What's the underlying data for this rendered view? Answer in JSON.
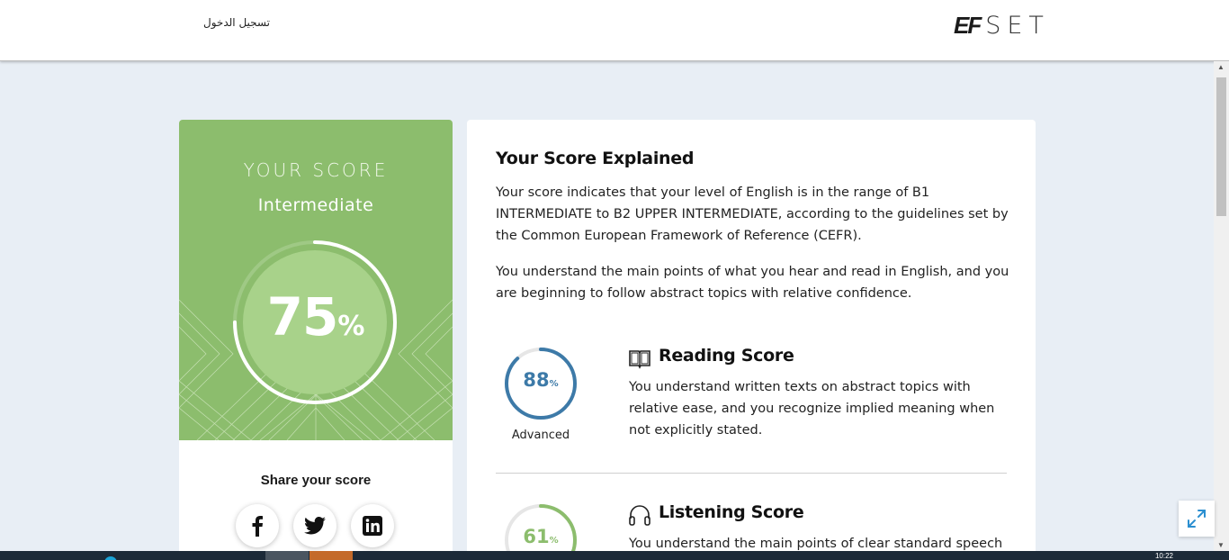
{
  "header": {
    "login_label": "تسجيل الدخول",
    "logo_ef": "EF",
    "logo_set": "SET"
  },
  "score_card": {
    "heading": "YOUR SCORE",
    "level": "Intermediate",
    "score_value": "75",
    "score_unit": "%",
    "score_fraction": 0.75,
    "share_title": "Share your score",
    "share_buttons": [
      "facebook-icon",
      "twitter-icon",
      "linkedin-icon"
    ]
  },
  "explanation": {
    "title": "Your Score Explained",
    "paragraph1": "Your score indicates that your level of English is in the range of B1 INTERMEDIATE to B2 UPPER INTERMEDIATE, according to the guidelines set by the Common European Framework of Reference (CEFR).",
    "paragraph2": "You understand the main points of what you hear and read in English, and you are beginning to follow abstract topics with relative confidence.",
    "skills": [
      {
        "title": "Reading Score",
        "icon": "book-icon",
        "score": "88",
        "unit": "%",
        "fraction": 0.88,
        "level": "Advanced",
        "color": "#3d7aa8",
        "description": "You understand written texts on abstract topics with relative ease, and you recognize implied meaning when not explicitly stated."
      },
      {
        "title": "Listening Score",
        "icon": "headphones-icon",
        "score": "61",
        "unit": "%",
        "fraction": 0.61,
        "level": "",
        "color": "#8cbd6d",
        "description": "You understand the main points of clear standard speech on a"
      }
    ]
  },
  "colors": {
    "accent_green": "#8cbd6d",
    "reading_blue": "#3d7aa8",
    "page_bg": "#e8eef5"
  },
  "taskbar": {
    "clock": "10:22"
  }
}
